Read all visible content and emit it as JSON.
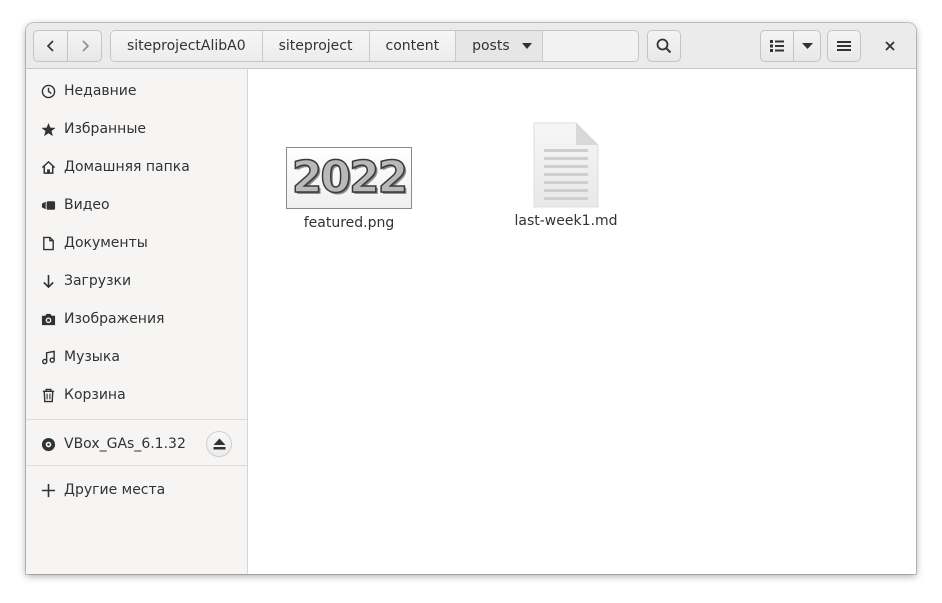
{
  "pathbar": {
    "crumbs": [
      "siteprojectAlibA0",
      "siteproject",
      "content",
      "posts"
    ]
  },
  "sidebar": {
    "places": [
      {
        "label": "Недавние",
        "icon": "clock-icon"
      },
      {
        "label": "Избранные",
        "icon": "star-icon"
      },
      {
        "label": "Домашняя папка",
        "icon": "home-icon"
      },
      {
        "label": "Видео",
        "icon": "video-icon"
      },
      {
        "label": "Документы",
        "icon": "document-icon"
      },
      {
        "label": "Загрузки",
        "icon": "download-icon"
      },
      {
        "label": "Изображения",
        "icon": "camera-icon"
      },
      {
        "label": "Музыка",
        "icon": "music-icon"
      },
      {
        "label": "Корзина",
        "icon": "trash-icon"
      }
    ],
    "devices": [
      {
        "label": "VBox_GAs_6.1.32",
        "icon": "disc-icon"
      }
    ],
    "other": {
      "label": "Другие места",
      "icon": "plus-icon"
    }
  },
  "files": [
    {
      "name": "featured.png",
      "type": "image",
      "thumb_text": "2022"
    },
    {
      "name": "last-week1.md",
      "type": "text-document"
    }
  ]
}
